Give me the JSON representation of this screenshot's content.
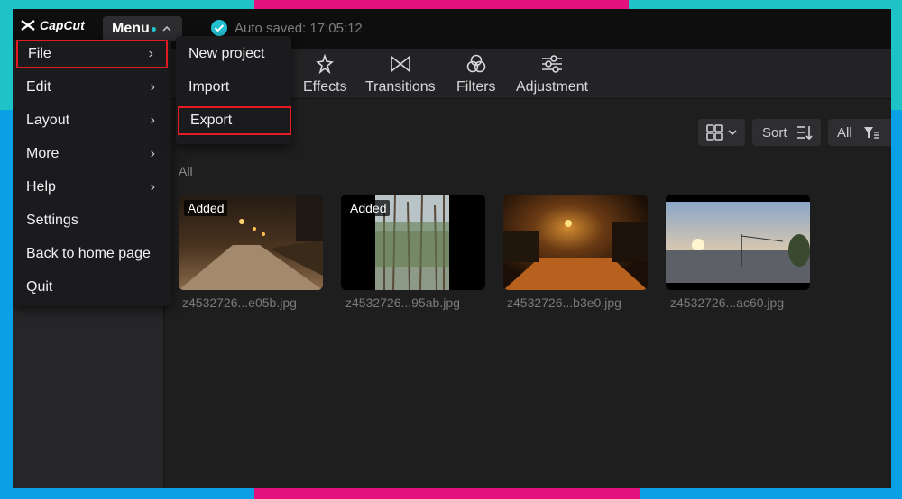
{
  "app": {
    "logo_text": "CapCut",
    "menu_label": "Menu",
    "autosave_text": "Auto saved: 17:05:12"
  },
  "toolbar": {
    "items": [
      {
        "label": "Effects",
        "icon": "sparkle-icon"
      },
      {
        "label": "Transitions",
        "icon": "bowtie-icon"
      },
      {
        "label": "Filters",
        "icon": "circles-icon"
      },
      {
        "label": "Adjustment",
        "icon": "sliders-icon"
      }
    ]
  },
  "controls": {
    "sort_label": "Sort",
    "all_label": "All"
  },
  "section_label": "All",
  "media": [
    {
      "name": "z4532726...e05b.jpg",
      "badge": "Added"
    },
    {
      "name": "z4532726...95ab.jpg",
      "badge": "Added"
    },
    {
      "name": "z4532726...b3e0.jpg",
      "badge": ""
    },
    {
      "name": "z4532726...ac60.jpg",
      "badge": ""
    }
  ],
  "menu": {
    "items": [
      {
        "label": "File",
        "has_submenu": true,
        "highlighted": true
      },
      {
        "label": "Edit",
        "has_submenu": true
      },
      {
        "label": "Layout",
        "has_submenu": true
      },
      {
        "label": "More",
        "has_submenu": true
      },
      {
        "label": "Help",
        "has_submenu": true
      },
      {
        "label": "Settings",
        "has_submenu": false
      },
      {
        "label": "Back to home page",
        "has_submenu": false
      },
      {
        "label": "Quit",
        "has_submenu": false
      }
    ],
    "file_submenu": [
      {
        "label": "New project"
      },
      {
        "label": "Import"
      },
      {
        "label": "Export",
        "highlighted": true
      }
    ]
  },
  "colors": {
    "accent": "#22c3cf",
    "highlight_border": "#e31c24",
    "frame_teal": "#1ec3c8",
    "frame_pink": "#e3127e",
    "frame_blue": "#0aa0e6"
  }
}
